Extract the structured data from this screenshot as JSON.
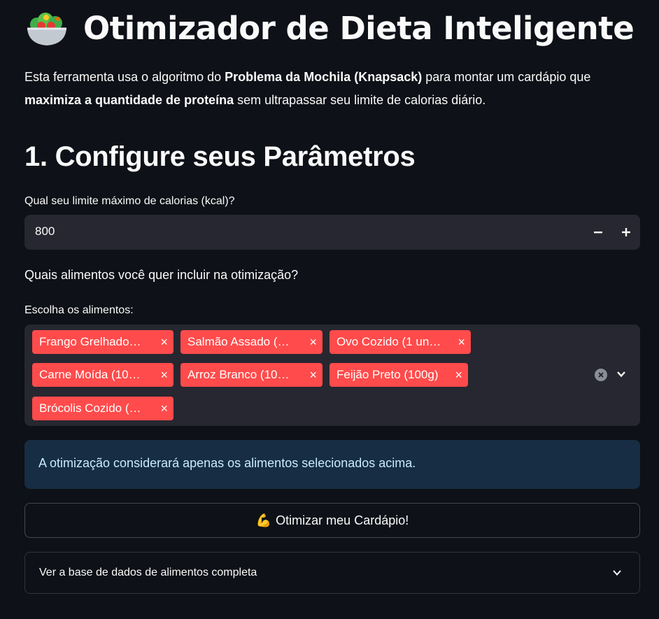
{
  "header": {
    "icon": "salad-bowl-icon",
    "title": "Otimizador de Dieta Inteligente"
  },
  "intro": {
    "part1": "Esta ferramenta usa o algoritmo do ",
    "bold1": "Problema da Mochila (Knapsack)",
    "part2": " para montar um cardápio que ",
    "bold2": "maximiza a quantidade de proteína",
    "part3": " sem ultrapassar seu limite de calorias diário."
  },
  "section": {
    "title": "1. Configure seus Parâmetros"
  },
  "calories": {
    "label": "Qual seu limite máximo de calorias (kcal)?",
    "value": "800",
    "decrement_icon": "minus-icon",
    "increment_icon": "plus-icon"
  },
  "foods_question": "Quais alimentos você quer incluir na otimização?",
  "foods": {
    "label": "Escolha os alimentos:",
    "selected": [
      "Frango Grelhado…",
      "Salmão Assado (…",
      "Ovo Cozido (1 un…",
      "Carne Moída (10…",
      "Arroz Branco (10…",
      "Feijão Preto (100g)",
      "Brócolis Cozido (…"
    ],
    "remove_glyph": "×",
    "clear_icon": "clear-circle-icon",
    "dropdown_icon": "chevron-down-icon"
  },
  "info": {
    "text": "A otimização considerará apenas os alimentos selecionados acima."
  },
  "optimize_button": {
    "emoji": "💪",
    "icon": "flexed-biceps-icon",
    "label": "Otimizar meu Cardápio!"
  },
  "expander": {
    "label": "Ver a base de dados de alimentos completa",
    "icon": "chevron-down-icon"
  },
  "colors": {
    "background": "#0e1117",
    "widget": "#262730",
    "tag": "#ff4b4b",
    "info_bg": "#172d43",
    "info_text": "#c7ebff"
  }
}
